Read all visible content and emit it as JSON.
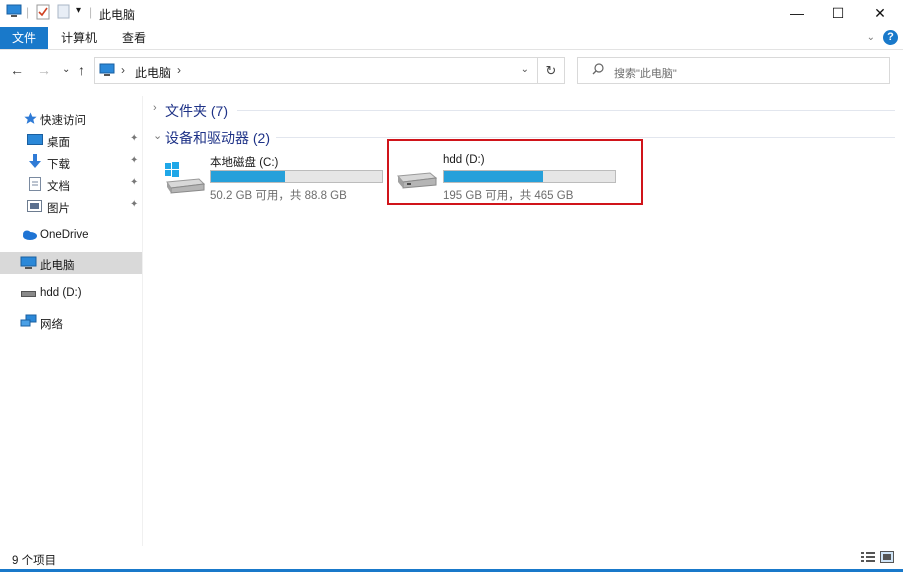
{
  "window": {
    "title": "此电脑",
    "qat_dropdown": "▾",
    "controls": {
      "minimize": "—",
      "maximize": "☐",
      "close": "✕"
    }
  },
  "ribbon": {
    "tabs": [
      {
        "label": "文件",
        "active": true
      },
      {
        "label": "计算机",
        "active": false
      },
      {
        "label": "查看",
        "active": false
      }
    ],
    "expand_glyph": "⌄",
    "help_label": "?"
  },
  "nav": {
    "back": "←",
    "forward": "→",
    "recent": "⌄",
    "up": "↑",
    "address": {
      "segments": [
        "此电脑"
      ],
      "separator": "›",
      "dropdown": "⌄"
    },
    "refresh": "↻",
    "search": {
      "placeholder": "搜索\"此电脑\""
    }
  },
  "sidebar": {
    "items": [
      {
        "label": "快速访问",
        "icon": "star-icon"
      },
      {
        "label": "桌面",
        "icon": "desktop-icon",
        "pinned": true
      },
      {
        "label": "下载",
        "icon": "download-icon",
        "pinned": true
      },
      {
        "label": "文档",
        "icon": "document-icon",
        "pinned": true
      },
      {
        "label": "图片",
        "icon": "pictures-icon",
        "pinned": true
      },
      {
        "label": "OneDrive",
        "icon": "cloud-icon"
      },
      {
        "label": "此电脑",
        "icon": "computer-icon",
        "selected": true
      },
      {
        "label": "hdd (D:)",
        "icon": "drive-icon"
      },
      {
        "label": "网络",
        "icon": "network-icon"
      }
    ],
    "pin_glyph": "📌"
  },
  "content": {
    "groups": [
      {
        "title": "文件夹 (7)",
        "collapsed": true,
        "chevron": "›"
      },
      {
        "title": "设备和驱动器 (2)",
        "collapsed": false,
        "chevron": "⌄"
      }
    ],
    "drives": [
      {
        "name": "本地磁盘 (C:)",
        "info": "50.2 GB 可用，共 88.8 GB",
        "used_fraction": 0.435,
        "icon": "windows-drive-icon"
      },
      {
        "name": "hdd (D:)",
        "info": "195 GB 可用，共 465 GB",
        "used_fraction": 0.581,
        "icon": "drive-icon",
        "highlighted": true
      }
    ]
  },
  "status": {
    "item_count": "9 个项目"
  },
  "colors": {
    "accent": "#1979ca",
    "usage_bar": "#26a0da",
    "highlight": "#d0141a",
    "group_title": "#1e3287"
  }
}
